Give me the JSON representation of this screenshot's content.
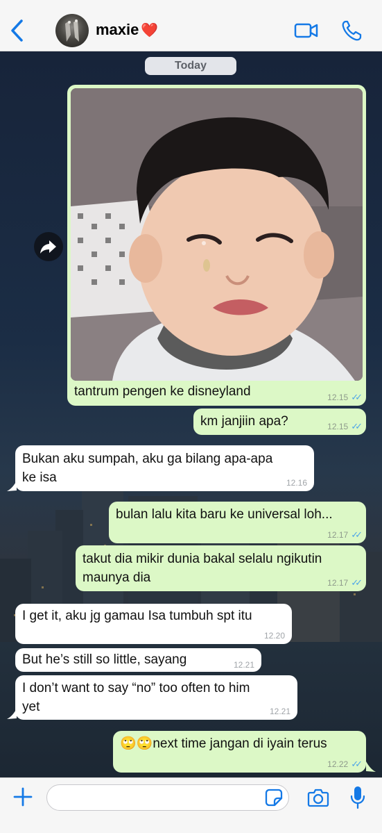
{
  "header": {
    "back_icon": "chevron-left-icon",
    "contact_name": "maxie",
    "heart": "❤️",
    "video_icon": "video-camera-icon",
    "call_icon": "phone-icon",
    "accent_color": "#1479e6"
  },
  "chat": {
    "date_label": "Today",
    "messages": [
      {
        "direction": "out",
        "type": "image",
        "caption": "tantrum pengen ke disneyland",
        "time": "12.15",
        "status": "read"
      },
      {
        "direction": "out",
        "text": "km janjiin apa?",
        "time": "12.15",
        "status": "read"
      },
      {
        "direction": "in",
        "lines": [
          "Bukan aku sumpah, aku ga bilang apa-apa",
          "ke isa"
        ],
        "time": "12.16"
      },
      {
        "direction": "out",
        "text": "bulan lalu kita baru ke universal loh...",
        "time": "12.17",
        "status": "read"
      },
      {
        "direction": "out",
        "lines": [
          "takut dia mikir dunia bakal selalu ngikutin",
          "maunya dia"
        ],
        "time": "12.17",
        "status": "read"
      },
      {
        "direction": "in",
        "text": "I get it, aku jg gamau Isa tumbuh spt itu",
        "time": "12.20"
      },
      {
        "direction": "in",
        "text": "But he’s still so little, sayang",
        "time": "12.21"
      },
      {
        "direction": "in",
        "lines": [
          "I don’t want to say “no” too often to him",
          "yet"
        ],
        "time": "12.21"
      },
      {
        "direction": "out",
        "text": "🙄🙄next time jangan di iyain terus",
        "time": "12.22",
        "status": "read"
      }
    ],
    "outgoing_color": "#dcf8c6",
    "incoming_color": "#ffffff",
    "read_tick_color": "#4fa6e8",
    "forward_icon": "forward-arrow-icon"
  },
  "composer": {
    "plus_icon": "plus-icon",
    "input_value": "",
    "sticker_icon": "sticker-icon",
    "camera_icon": "camera-icon",
    "mic_icon": "microphone-icon"
  }
}
